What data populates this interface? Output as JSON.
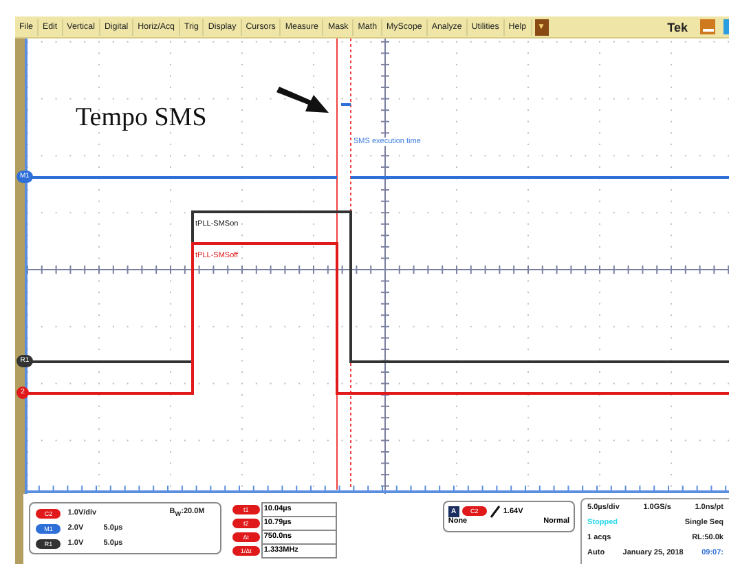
{
  "menu_bar": {
    "items": [
      "File",
      "Edit",
      "Vertical",
      "Digital",
      "Horiz/Acq",
      "Trig",
      "Display",
      "Cursors",
      "Measure",
      "Mask",
      "Math",
      "MyScope",
      "Analyze",
      "Utilities",
      "Help"
    ],
    "dropdown_icon": "▼",
    "brand": "Tek"
  },
  "scope": {
    "annotation": "Tempo SMS",
    "labels": [
      {
        "text": "SMS execution time",
        "color": "#3a7be0"
      },
      {
        "text": "tPLL-SMSon",
        "color": "#111111"
      },
      {
        "text": "tPLL-SMSoff",
        "color": "#e01010"
      }
    ],
    "channel_markers": [
      {
        "label": "M1",
        "color": "#2f6fd8"
      },
      {
        "label": "R1",
        "color": "#333333"
      },
      {
        "label": "2",
        "color": "#e0191b"
      }
    ]
  },
  "channel_readout": {
    "rows": [
      {
        "badge": "C2",
        "color": "#e0191b",
        "values": [
          "1.0V/div"
        ]
      },
      {
        "badge": "M1",
        "color": "#2f6fd8",
        "values": [
          "2.0V",
          "5.0µs"
        ]
      },
      {
        "badge": "R1",
        "color": "#333333",
        "values": [
          "1.0V",
          "5.0µs"
        ]
      }
    ],
    "bandwidth": "B$_{W}$:20.0M"
  },
  "cursors": [
    {
      "badge": "t1",
      "value": "10.04µs"
    },
    {
      "badge": "t2",
      "value": "10.79µs"
    },
    {
      "badge": "Δt",
      "value": "750.0ns"
    },
    {
      "badge": "1/Δt",
      "value": "1.333MHz"
    }
  ],
  "trigger": {
    "type_icon": "A",
    "badge": "C2",
    "threshold": "1.64V",
    "coupling": "None",
    "mode": "Normal"
  },
  "acquisition": {
    "horizontal_scale": "5.0µs/div",
    "sample_rate": "1.0GS/s",
    "resolution": "1.0ns/pt",
    "state": "Stopped",
    "run_mode": "Single Seq",
    "acquisitions": "1 acqs",
    "record_length": "RL:50.0k",
    "trigger_mode": "Auto",
    "date": "January 25, 2018",
    "time": "09:07:"
  }
}
